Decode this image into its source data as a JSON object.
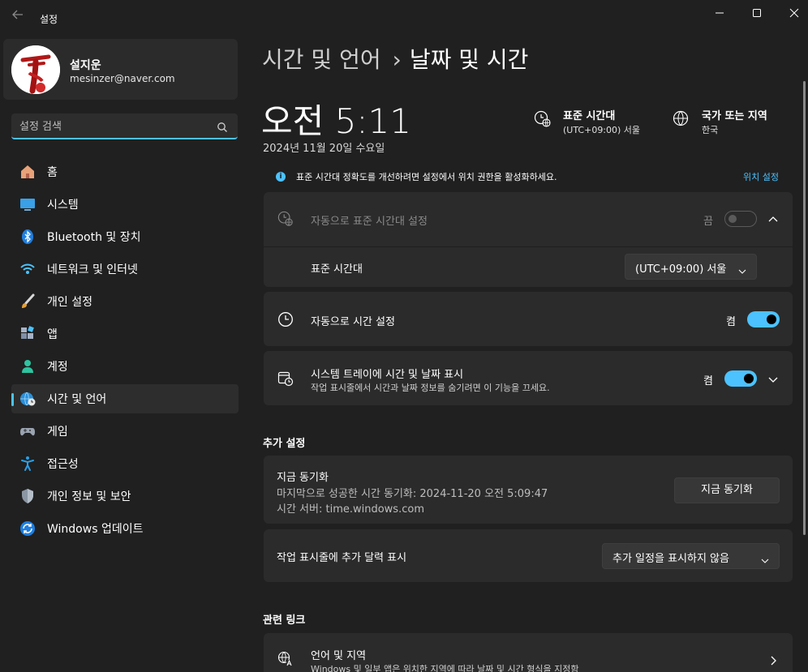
{
  "titlebar": {
    "title": "설정",
    "back_icon": "arrow-left-icon"
  },
  "profile": {
    "name": "설지운",
    "email": "mesinzer@naver.com"
  },
  "search": {
    "placeholder": "설정 검색",
    "value": ""
  },
  "nav": [
    {
      "label": "홈",
      "icon": "home-icon"
    },
    {
      "label": "시스템",
      "icon": "monitor-icon"
    },
    {
      "label": "Bluetooth 및 장치",
      "icon": "bluetooth-icon"
    },
    {
      "label": "네트워크 및 인터넷",
      "icon": "wifi-icon"
    },
    {
      "label": "개인 설정",
      "icon": "brush-icon"
    },
    {
      "label": "앱",
      "icon": "apps-icon"
    },
    {
      "label": "계정",
      "icon": "person-icon"
    },
    {
      "label": "시간 및 언어",
      "icon": "globe-clock-icon",
      "active": true
    },
    {
      "label": "게임",
      "icon": "gamepad-icon"
    },
    {
      "label": "접근성",
      "icon": "accessibility-icon"
    },
    {
      "label": "개인 정보 및 보안",
      "icon": "shield-icon"
    },
    {
      "label": "Windows 업데이트",
      "icon": "update-icon"
    }
  ],
  "breadcrumb": {
    "parent": "시간 및 언어",
    "separator": "›",
    "current": "날짜 및 시간"
  },
  "clock": {
    "time": "오전 5:11",
    "date": "2024년 11월 20일 수요일"
  },
  "timezone_info": {
    "title": "표준 시간대",
    "value": "(UTC+09:00) 서울"
  },
  "region_info": {
    "title": "국가 또는 지역",
    "value": "한국"
  },
  "notice": {
    "text": "표준 시간대 정확도를 개선하려면 설정에서 위치 권한을 활성화하세요.",
    "link": "위치 설정"
  },
  "auto_timezone": {
    "label": "자동으로 표준 시간대 설정",
    "state": "끔",
    "on": false
  },
  "timezone_select": {
    "label": "표준 시간대",
    "value": "(UTC+09:00) 서울"
  },
  "auto_time": {
    "label": "자동으로 시간 설정",
    "state": "켬",
    "on": true
  },
  "tray": {
    "label": "시스템 트레이에 시간 및 날짜 표시",
    "sub": "작업 표시줄에서 시간과 날짜 정보를 숨기려면 이 기능을 끄세요.",
    "state": "켬",
    "on": true
  },
  "additional": {
    "title": "추가 설정"
  },
  "sync": {
    "title": "지금 동기화",
    "last": "마지막으로 성공한 시간 동기화: 2024-11-20 오전 5:09:47",
    "server": "시간 서버: time.windows.com",
    "button": "지금 동기화"
  },
  "calendar": {
    "label": "작업 표시줄에 추가 달력 표시",
    "value": "추가 일정을 표시하지 않음"
  },
  "related": {
    "title": "관련 링크"
  },
  "lang_region": {
    "title": "언어 및 지역",
    "sub": "Windows 및 일부 앱은 위치한 지역에 따라 날짜 및 시간 형식을 지정함"
  },
  "colors": {
    "accent": "#4cc2ff",
    "background": "#202020",
    "card": "#2b2b2b"
  }
}
